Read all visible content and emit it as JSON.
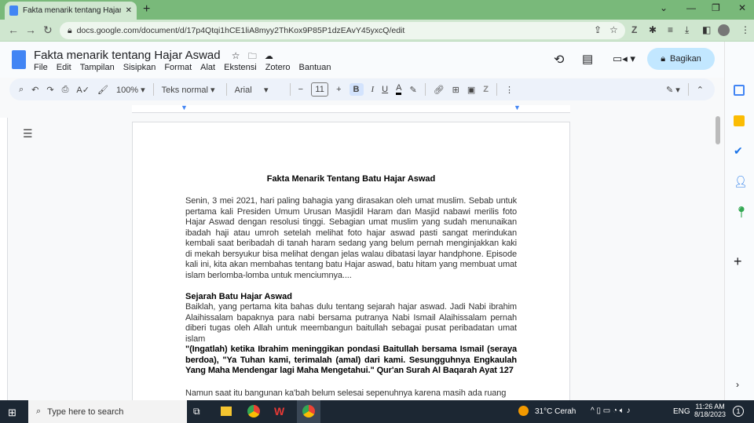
{
  "browser": {
    "tab_title": "Fakta menarik tentang Hajar Asw",
    "url": "docs.google.com/document/d/17p4Qtqi1hCE1liA8myy2ThKox9P85P1dzEAvY45yxcQ/edit"
  },
  "docs": {
    "title": "Fakta menarik tentang Hajar Aswad",
    "menu": [
      "File",
      "Edit",
      "Tampilan",
      "Sisipkan",
      "Format",
      "Alat",
      "Ekstensi",
      "Zotero",
      "Bantuan"
    ],
    "share_label": "Bagikan"
  },
  "toolbar": {
    "zoom": "100%",
    "style": "Teks normal",
    "font": "Arial",
    "font_size": "11",
    "bold": "B",
    "italic": "I",
    "underline": "U",
    "text_color": "A"
  },
  "document": {
    "title": "Fakta Menarik Tentang Batu Hajar Aswad",
    "p1": "Senin, 3 mei 2021, hari paling bahagia yang dirasakan oleh umat muslim. Sebab untuk pertama kali Presiden Umum Urusan Masjidil Haram dan Masjid nabawi merilis foto Hajar Aswad dengan resolusi tinggi. Sebagian umat muslim yang sudah menunaikan ibadah haji atau umroh setelah melihat foto hajar aswad pasti sangat merindukan kembali saat beribadah di tanah haram sedang yang belum pernah menginjakkan kaki di mekah bersyukur bisa melihat dengan jelas walau dibatasi layar handphone. Episode kali ini, kita akan membahas tentang batu Hajar aswad, batu hitam yang membuat umat islam berlomba-lomba untuk menciumnya....",
    "h2": "Sejarah Batu Hajar Aswad",
    "p2": "Baiklah, yang pertama kita bahas dulu tentang sejarah hajar aswad. Jadi Nabi ibrahim Alaihissalam bapaknya para nabi bersama putranya Nabi Ismail Alaihissalam pernah diberi tugas oleh Allah untuk meembangun baitullah sebagai pusat peribadatan umat islam",
    "quote": "\"(Ingatlah) ketika Ibrahim meninggikan pondasi Baitullah bersama Ismail (seraya berdoa), \"Ya Tuhan kami, terimalah (amal) dari kami. Sesungguhnya Engkaulah Yang Maha Mendengar lagi Maha Mengetahui.\" Qur'an Surah Al Baqarah Ayat 127",
    "p3": "Namun saat itu bangunan ka'bah belum selesai sepenuhnya karena masih ada ruang"
  },
  "taskbar": {
    "search_placeholder": "Type here to search",
    "weather": "31°C  Cerah",
    "lang": "ENG",
    "time": "11:26 AM",
    "date": "8/18/2023",
    "notif_count": "1"
  }
}
